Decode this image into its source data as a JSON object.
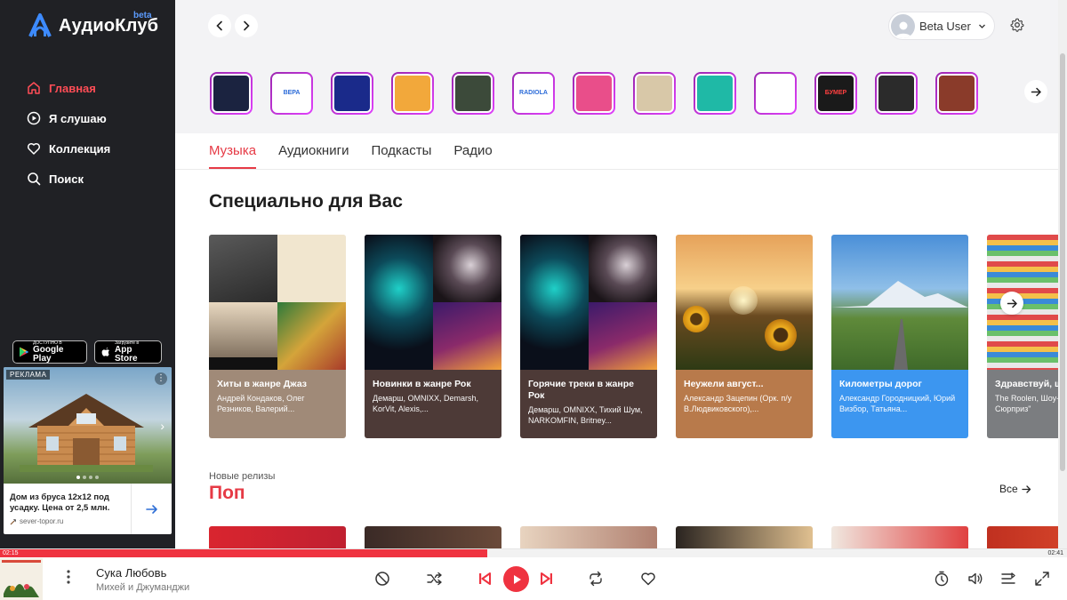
{
  "app": {
    "brand": "АудиоКлуб",
    "beta": "beta"
  },
  "sidebar": {
    "nav": [
      {
        "label": "Главная",
        "icon": "home-icon",
        "active": true
      },
      {
        "label": "Я слушаю",
        "icon": "play-circle-icon",
        "active": false
      },
      {
        "label": "Коллекция",
        "icon": "heart-icon",
        "active": false
      },
      {
        "label": "Поиск",
        "icon": "search-icon",
        "active": false
      }
    ],
    "stores": {
      "google_small": "ДОСТУПНО В",
      "google_big": "Google Play",
      "apple_small": "Загрузите в",
      "apple_big": "App Store"
    },
    "ad": {
      "label": "РЕКЛАМА",
      "title": "Дом из бруса 12х12 под усадку. Цена от 2,5 млн.",
      "site": "sever-topor.ru"
    }
  },
  "header": {
    "user_name": "Beta User"
  },
  "stories": [
    {
      "text": "",
      "bg": "#1b2340"
    },
    {
      "text": "ВЕРА",
      "bg": "#ffffff"
    },
    {
      "text": "",
      "bg": "#1a2a8a"
    },
    {
      "text": "",
      "bg": "#f2a83b"
    },
    {
      "text": "",
      "bg": "#3c4a3a"
    },
    {
      "text": "RADIOLA",
      "bg": "#ffffff"
    },
    {
      "text": "",
      "bg": "#e94e8a"
    },
    {
      "text": "",
      "bg": "#d8c8a8"
    },
    {
      "text": "",
      "bg": "#1fb9a6"
    },
    {
      "text": "",
      "bg": "#ffffff"
    },
    {
      "text": "БУМЕР",
      "bg": "#1a1a1a"
    },
    {
      "text": "",
      "bg": "#2b2b2b"
    },
    {
      "text": "",
      "bg": "#8a3b2a"
    }
  ],
  "tabs": [
    {
      "label": "Музыка",
      "active": true
    },
    {
      "label": "Аудиокниги",
      "active": false
    },
    {
      "label": "Подкасты",
      "active": false
    },
    {
      "label": "Радио",
      "active": false
    }
  ],
  "section": {
    "title": "Специально для Вас"
  },
  "cards": [
    {
      "title": "Хиты в жанре Джаз",
      "subtitle": "Андрей Кондаков, Олег Резников, Валерий...",
      "color": "#a08a78"
    },
    {
      "title": "Новинки в жанре Рок",
      "subtitle": "Демарш, OMNIXX, Demarsh, KorVit, Alexis,...",
      "color": "#4d3a37"
    },
    {
      "title": "Горячие треки в жанре Рок",
      "subtitle": "Демарш, OMNIXX, Тихий Шум, NARKOMFIN, Britney...",
      "color": "#4d3a37"
    },
    {
      "title": "Неужели август...",
      "subtitle": "Александр Зацепин (Орк. п/у В.Людвиковского),...",
      "color": "#b87a4b"
    },
    {
      "title": "Километры дорог",
      "subtitle": "Александр Городницкий, Юрий Визбор, Татьяна...",
      "color": "#3c96f0"
    },
    {
      "title": "Здравствуй, шу...",
      "subtitle": "The Roolen, Шоу-Г... \"Киндер Сюрприз\"",
      "color": "#7b7d80"
    }
  ],
  "new_releases": {
    "label": "Новые релизы",
    "title": "Поп",
    "all": "Все"
  },
  "player": {
    "current_time": "02:15",
    "total_time": "02:41",
    "progress": 0.457,
    "track_title": "Сука Любовь",
    "track_artist": "Михей и Джуманджи"
  },
  "colors": {
    "accent": "#ef3340",
    "sidebar_bg": "#202125",
    "story_ring": "#b02fc8"
  }
}
